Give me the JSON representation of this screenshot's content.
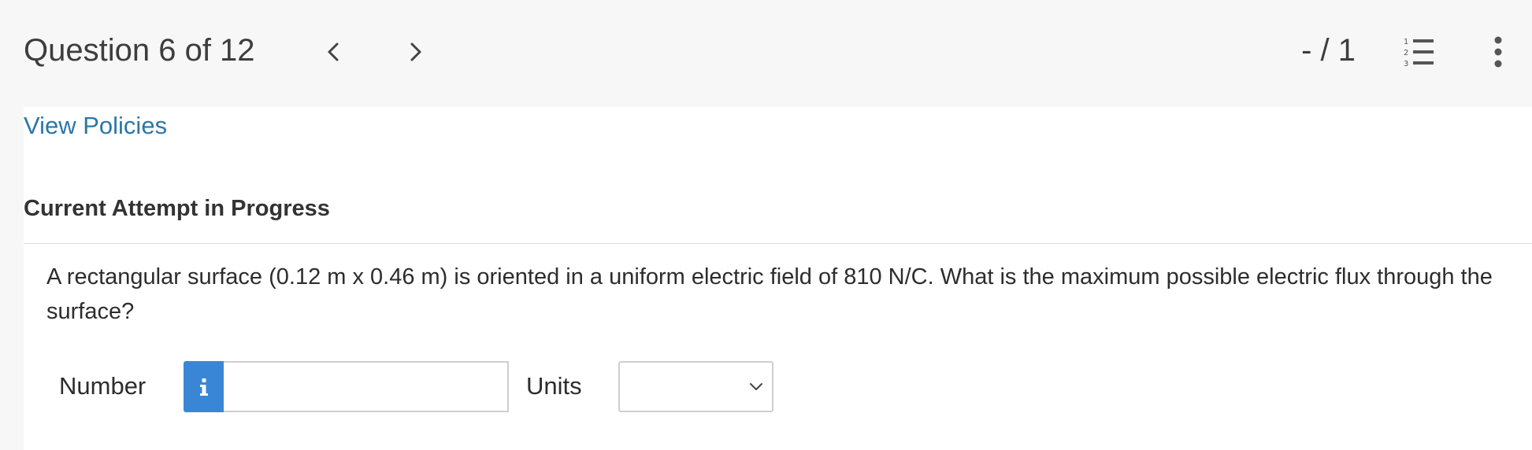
{
  "header": {
    "question_title": "Question 6 of 12",
    "score": "- / 1",
    "prev_icon": "chevron-left-icon",
    "next_icon": "chevron-right-icon",
    "list_icon": "numbered-list-icon",
    "more_icon": "vertical-dots-icon"
  },
  "policies": {
    "link_text": "View Policies"
  },
  "attempt": {
    "heading": "Current Attempt in Progress"
  },
  "question": {
    "text": "A rectangular surface (0.12 m x 0.46 m) is oriented in a uniform electric field of 810 N/C. What is the maximum possible electric flux through the surface?"
  },
  "answer": {
    "number_label": "Number",
    "number_value": "",
    "info_icon": "info-icon",
    "units_label": "Units",
    "units_selected": ""
  },
  "colors": {
    "link": "#2b77a8",
    "info_button": "#3a86d6",
    "background": "#f7f7f7"
  }
}
